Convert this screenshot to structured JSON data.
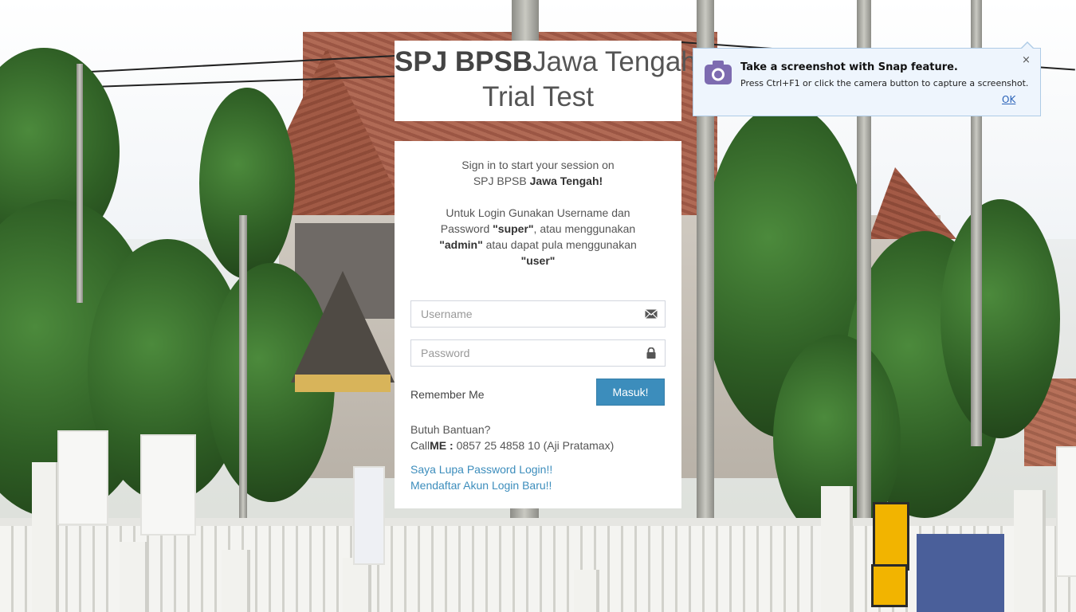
{
  "header": {
    "brand_bold": "SPJ BPSB",
    "brand_light": "Jawa Tengah!",
    "subtitle": "Trial Test"
  },
  "login": {
    "intro_line1": "Sign in to start your session on",
    "intro_line2_plain": "SPJ BPSB ",
    "intro_line2_bold": "Jawa Tengah!",
    "hint_line1": "Untuk Login Gunakan Username dan",
    "hint_password_prefix": "Password ",
    "hint_super": "\"super\"",
    "hint_super_suffix": ", atau menggunakan",
    "hint_admin": "\"admin\"",
    "hint_admin_suffix": " atau dapat pula menggunakan",
    "hint_user": "\"user\"",
    "username_placeholder": "Username",
    "username_value": "",
    "password_placeholder": "Password",
    "password_value": "",
    "remember_label": "Remember Me",
    "submit_label": "Masuk!",
    "help_title": "Butuh Bantuan?",
    "help_call_prefix": "Call",
    "help_call_bold": "ME :",
    "help_contact": " 0857 25 4858 10 (Aji Pratamax)",
    "forgot_link": "Saya Lupa Password Login!!",
    "register_link": "Mendaftar Akun Login Baru!!"
  },
  "snap_notice": {
    "title": "Take a screenshot with Snap feature.",
    "text": "Press Ctrl+F1 or click the camera button to capture a screenshot.",
    "ok_label": "OK",
    "close_label": "×",
    "icon": "camera-icon"
  },
  "colors": {
    "accent": "#3c8dbc",
    "snap_icon": "#7d6bb0"
  }
}
